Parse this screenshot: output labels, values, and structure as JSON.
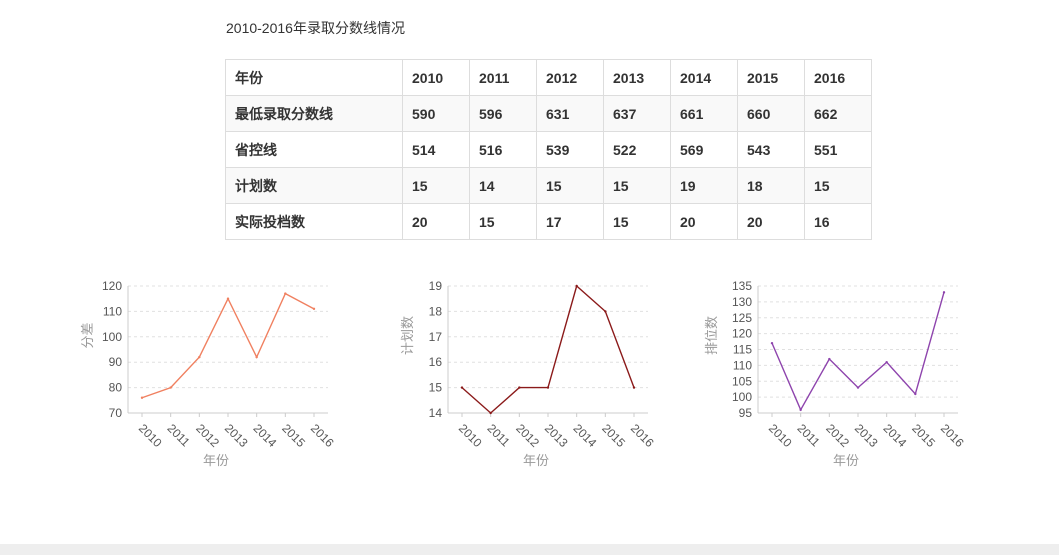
{
  "page": {
    "title": "2010-2016年录取分数线情况"
  },
  "table": {
    "rows": [
      {
        "label": "年份",
        "values": [
          "2010",
          "2011",
          "2012",
          "2013",
          "2014",
          "2015",
          "2016"
        ]
      },
      {
        "label": "最低录取分数线",
        "values": [
          "590",
          "596",
          "631",
          "637",
          "661",
          "660",
          "662"
        ]
      },
      {
        "label": "省控线",
        "values": [
          "514",
          "516",
          "539",
          "522",
          "569",
          "543",
          "551"
        ]
      },
      {
        "label": "计划数",
        "values": [
          "15",
          "14",
          "15",
          "15",
          "19",
          "18",
          "15"
        ]
      },
      {
        "label": "实际投档数",
        "values": [
          "20",
          "15",
          "17",
          "15",
          "20",
          "20",
          "16"
        ]
      }
    ]
  },
  "chart_data": [
    {
      "type": "line",
      "categories": [
        "2010",
        "2011",
        "2012",
        "2013",
        "2014",
        "2015",
        "2016"
      ],
      "series": [
        {
          "values": [
            76,
            80,
            92,
            115,
            92,
            117,
            111
          ]
        }
      ],
      "xlabel": "年份",
      "ylabel": "分差",
      "ylim": [
        70,
        120
      ],
      "yticks": [
        70,
        80,
        90,
        100,
        110,
        120
      ],
      "grid": true,
      "color": "#f08060"
    },
    {
      "type": "line",
      "categories": [
        "2010",
        "2011",
        "2012",
        "2013",
        "2014",
        "2015",
        "2016"
      ],
      "series": [
        {
          "values": [
            15,
            14,
            15,
            15,
            19,
            18,
            15
          ]
        }
      ],
      "xlabel": "年份",
      "ylabel": "计划数",
      "ylim": [
        14,
        19
      ],
      "yticks": [
        14,
        15,
        16,
        17,
        18,
        19
      ],
      "grid": true,
      "color": "#8b1a1a"
    },
    {
      "type": "line",
      "categories": [
        "2010",
        "2011",
        "2012",
        "2013",
        "2014",
        "2015",
        "2016"
      ],
      "series": [
        {
          "values": [
            117,
            96,
            112,
            103,
            111,
            101,
            133
          ]
        }
      ],
      "xlabel": "年份",
      "ylabel": "排位数",
      "ylim": [
        95,
        135
      ],
      "yticks": [
        95,
        100,
        105,
        110,
        115,
        120,
        125,
        130,
        135
      ],
      "grid": true,
      "color": "#8e44ad"
    }
  ]
}
